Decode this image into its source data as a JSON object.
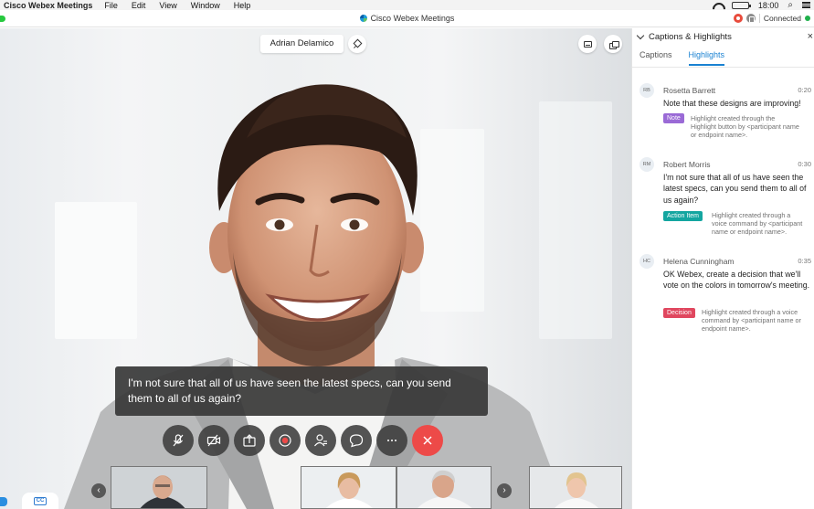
{
  "menubar": {
    "app_name": "Cisco Webex Meetings",
    "items": [
      "File",
      "Edit",
      "View",
      "Window",
      "Help"
    ],
    "clock": "18:00"
  },
  "titlebar": {
    "title": "Cisco Webex Meetings",
    "status": "Connected"
  },
  "stage": {
    "speaker_name": "Adrian Delamico",
    "caption": "I'm not sure that all of us have seen the latest specs, can you send them to all of us again?",
    "controls": [
      {
        "name": "mute-button",
        "icon": "microphone-muted-icon"
      },
      {
        "name": "video-button",
        "icon": "camera-off-icon"
      },
      {
        "name": "share-button",
        "icon": "share-icon"
      },
      {
        "name": "record-button",
        "icon": "record-icon"
      },
      {
        "name": "participants-button",
        "icon": "participants-icon"
      },
      {
        "name": "chat-button",
        "icon": "chat-icon"
      },
      {
        "name": "more-button",
        "icon": "more-icon"
      },
      {
        "name": "end-call-button",
        "icon": "close-icon"
      }
    ],
    "colors": {
      "end_call": "#ed4a48",
      "accent": "#1a82d2"
    }
  },
  "panel": {
    "title": "Captions & Highlights",
    "tabs": [
      "Captions",
      "Highlights"
    ],
    "active_tab": "Highlights",
    "entries": [
      {
        "initials": "RB",
        "name": "Rosetta Barrett",
        "time": "0:20",
        "text": "Note that these designs are improving!",
        "tag": "Note",
        "tag_color": "#9a6ad6",
        "note_lines": [
          "Highlight created through the",
          "Highlight button by <participant name",
          "or endpoint name>."
        ]
      },
      {
        "initials": "RM",
        "name": "Robert Morris",
        "time": "0:30",
        "text": "I'm not sure that all of us have seen the latest specs, can you send them to all of us again?",
        "tag": "Action Item",
        "tag_color": "#14a6a0",
        "note_lines": [
          "Highlight created through a",
          "voice command by <participant",
          "name or endpoint name>."
        ]
      },
      {
        "initials": "HC",
        "name": "Helena Cunningham",
        "time": "0:35",
        "text": "OK Webex, create a decision that we'll vote on the colors in tomorrow's meeting.",
        "tag": "Decision",
        "tag_color": "#e0475f",
        "note_lines": [
          "Highlight created through a voice",
          "command by <participant name or",
          "endpoint name>."
        ]
      }
    ]
  }
}
